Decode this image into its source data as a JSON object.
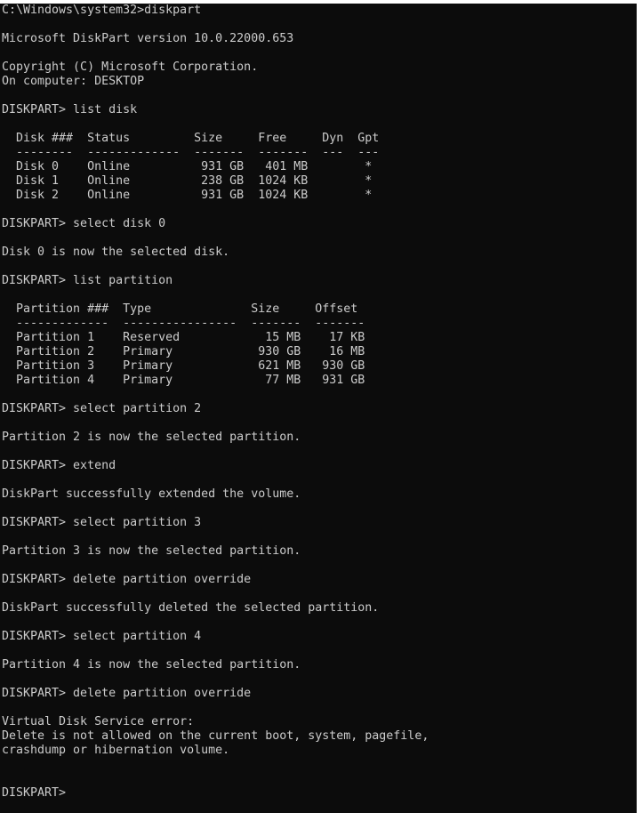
{
  "console": {
    "lines": [
      "C:\\Windows\\system32>diskpart",
      "",
      "Microsoft DiskPart version 10.0.22000.653",
      "",
      "Copyright (C) Microsoft Corporation.",
      "On computer: DESKTOP",
      "",
      "DISKPART> list disk",
      "",
      "  Disk ###  Status         Size     Free     Dyn  Gpt",
      "  --------  -------------  -------  -------  ---  ---",
      "  Disk 0    Online          931 GB   401 MB        *",
      "  Disk 1    Online          238 GB  1024 KB        *",
      "  Disk 2    Online          931 GB  1024 KB        *",
      "",
      "DISKPART> select disk 0",
      "",
      "Disk 0 is now the selected disk.",
      "",
      "DISKPART> list partition",
      "",
      "  Partition ###  Type              Size     Offset",
      "  -------------  ----------------  -------  -------",
      "  Partition 1    Reserved            15 MB    17 KB",
      "  Partition 2    Primary            930 GB    16 MB",
      "  Partition 3    Primary            621 MB   930 GB",
      "  Partition 4    Primary             77 MB   931 GB",
      "",
      "DISKPART> select partition 2",
      "",
      "Partition 2 is now the selected partition.",
      "",
      "DISKPART> extend",
      "",
      "DiskPart successfully extended the volume.",
      "",
      "DISKPART> select partition 3",
      "",
      "Partition 3 is now the selected partition.",
      "",
      "DISKPART> delete partition override",
      "",
      "DiskPart successfully deleted the selected partition.",
      "",
      "DISKPART> select partition 4",
      "",
      "Partition 4 is now the selected partition.",
      "",
      "DISKPART> delete partition override",
      "",
      "Virtual Disk Service error:",
      "Delete is not allowed on the current boot, system, pagefile,",
      "crashdump or hibernation volume.",
      "",
      "",
      "DISKPART> "
    ]
  },
  "colors": {
    "background": "#0c0c0c",
    "text": "#cccccc"
  }
}
